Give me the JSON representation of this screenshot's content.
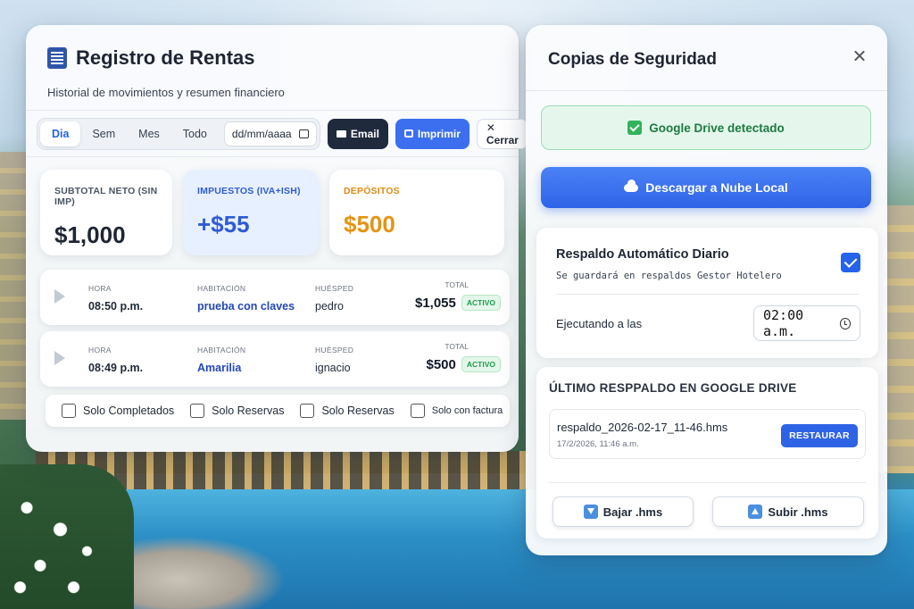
{
  "rentas": {
    "title": "Registro de Rentas",
    "subtitle": "Historial de movimientos y resumen financiero",
    "periods": [
      "Dia",
      "Sem",
      "Mes",
      "Todo"
    ],
    "active_period": "Dia",
    "date_placeholder": "dd/mm/aaaa",
    "email_label": "Email",
    "print_label": "Imprimir",
    "close_label": "✕ Cerrar",
    "cards": [
      {
        "label": "SUBTOTAL NETO (SIN IMP)",
        "value": "$1,000"
      },
      {
        "label": "IMPUESTOS (IVA+ISH)",
        "value": "+$55"
      },
      {
        "label": "DEPÓSITOS",
        "value": "$500"
      }
    ],
    "headers": {
      "hora": "HORA",
      "habitacion": "HABITACIÓN",
      "huesped": "HUÉSPED",
      "total": "TOTAL"
    },
    "rows": [
      {
        "hora": "08:50 p.m.",
        "habitacion": "prueba con claves",
        "huesped": "pedro",
        "total": "$1,055",
        "status": "ACTIVO"
      },
      {
        "hora": "08:49 p.m.",
        "habitacion": "Amarilia",
        "huesped": "ignacio",
        "total": "$500",
        "status": "ACTIVO"
      }
    ],
    "filters": [
      "Solo Completados",
      "Solo Reservas",
      "Solo Reservas",
      "Solo con factura"
    ]
  },
  "backup": {
    "title": "Copias de Seguridad",
    "drive_status": "Google Drive detectado",
    "download_label": "Descargar a Nube Local",
    "auto_title": "Respaldo Automático Diario",
    "auto_subtitle": "Se guardará en respaldos Gestor Hotelero",
    "auto_enabled": true,
    "exec_label": "Ejecutando a las",
    "exec_time": "02:00 a.m.",
    "last_title": "ÚLTIMO RESPPALDO EN GOOGLE DRIVE",
    "last_file": "respaldo_2026-02-17_11-46.hms",
    "last_date": "17/2/2026, 11:46 a.m.",
    "restore_label": "RESTAURAR",
    "download_hms": "Bajar .hms",
    "upload_hms": "Subir .hms"
  },
  "colors": {
    "accent": "#2f63e6",
    "dark_button": "#1f2a3d",
    "success": "#31b25b",
    "tax_blue": "#2f5bd3",
    "deposit_orange": "#e59313"
  }
}
